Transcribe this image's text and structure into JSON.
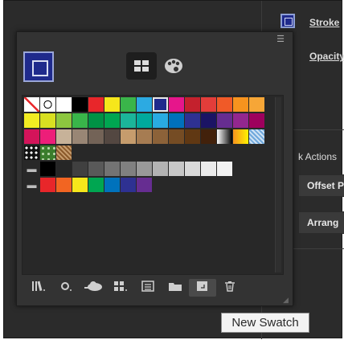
{
  "side_panel": {
    "stroke_label": "Stroke",
    "opacity_label": "Opacity",
    "quick_actions_label": "k Actions",
    "offset_path_label": "Offset P",
    "arrange_label": "Arrang"
  },
  "popup": {
    "menu_icon": "hamburger-menu-icon",
    "fill_color": "#1f2a8c",
    "views": [
      "grid-view-icon",
      "palette-view-icon"
    ]
  },
  "swatches": {
    "row1": [
      "none",
      "registration",
      "#ffffff",
      "#000000",
      "#e8262a",
      "#f6e71b",
      "#3ab54a",
      "#2caae2",
      "#1f2a8c",
      "#e6168b",
      "#c4212d",
      "#e33d3a",
      "#f05a28",
      "#f7931e",
      "#f6a637"
    ],
    "row2": [
      "#f2ec22",
      "#d8df21",
      "#8cc63f",
      "#39b54a",
      "#009245",
      "#00a651",
      "#1bb59a",
      "#00a99d",
      "#29abe2",
      "#0071bc",
      "#2e3192",
      "#1b1464",
      "#662d91",
      "#93278f",
      "#9e005d"
    ],
    "row3": [
      "#d4145a",
      "#ed1e79",
      "#c7b299",
      "#998675",
      "#736357",
      "#534741",
      "#c69c6d",
      "#a67c52",
      "#8c6239",
      "#754c24",
      "#603813",
      "#42210b",
      "grad-white-black",
      "grad-orange-yellow",
      "grad-blue"
    ],
    "row4": [
      "pattern-dots",
      "pattern-leaf",
      "pattern-brown"
    ],
    "row5": [
      "#000000",
      "#262626",
      "#404040",
      "#595959",
      "#737373",
      "#808080",
      "#999999",
      "#b3b3b3",
      "#c7c7c7",
      "#d9d9d9",
      "#ebebeb",
      "#f2f2f2"
    ],
    "row6": [
      "#e8262a",
      "#f26522",
      "#f6e71b",
      "#00a651",
      "#0072bc",
      "#2e3192",
      "#662d91"
    ]
  },
  "toolbar": {
    "icons": [
      "swatch-libraries-icon",
      "show-swatch-kinds-icon",
      "import-cloud-icon",
      "swatch-options-icon",
      "color-group-icon",
      "new-color-group-icon",
      "new-swatch-icon",
      "delete-swatch-icon"
    ]
  },
  "tooltip": {
    "text": "New Swatch"
  }
}
